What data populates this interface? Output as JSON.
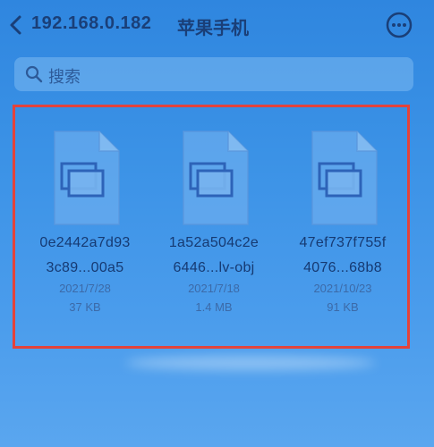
{
  "header": {
    "host": "192.168.0.182",
    "title": "苹果手机",
    "back_icon": "chevron-left-icon",
    "more_icon": "more-horizontal-icon"
  },
  "search": {
    "placeholder": "搜索",
    "icon": "search-icon"
  },
  "files": [
    {
      "name_line1": "0e2442a7d93",
      "name_line2": "3c89...00a5",
      "date": "2021/7/28",
      "size": "37 KB"
    },
    {
      "name_line1": "1a52a504c2e",
      "name_line2": "6446...lv-obj",
      "date": "2021/7/18",
      "size": "1.4 MB"
    },
    {
      "name_line1": "47ef737f755f",
      "name_line2": "4076...68b8",
      "date": "2021/10/23",
      "size": "91 KB"
    }
  ],
  "colors": {
    "background": "#3b92e6",
    "text_primary": "#1a3f78",
    "highlight_border": "#e3433b"
  }
}
